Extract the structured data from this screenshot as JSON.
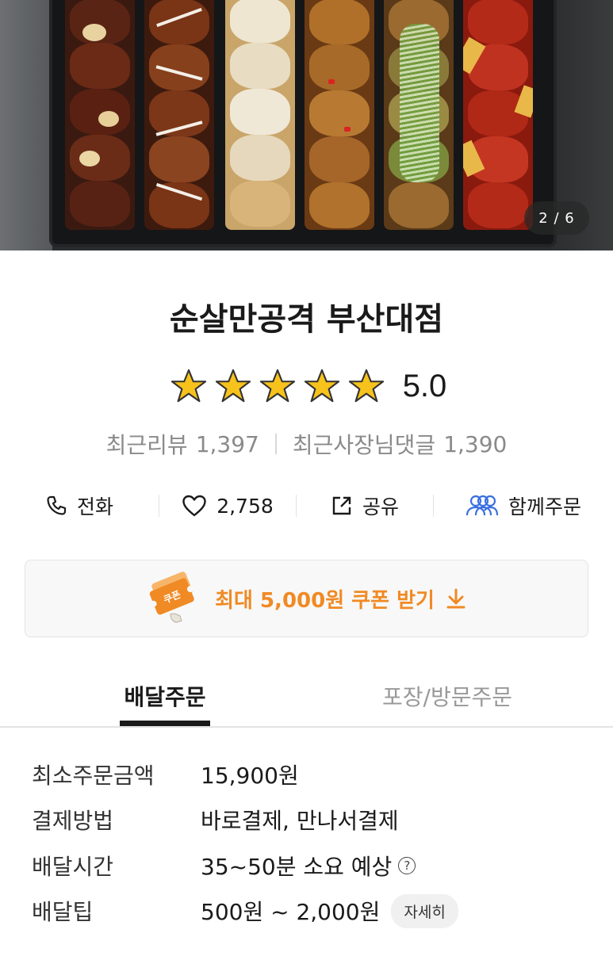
{
  "hero": {
    "page_indicator": "2 / 6",
    "current_index": 2,
    "total": 6
  },
  "store": {
    "name": "순살만공격 부산대점",
    "rating": "5.0",
    "rating_stars": 5,
    "recent_reviews_label": "최근리뷰",
    "recent_reviews_count": "1,397",
    "owner_replies_label": "최근사장님댓글",
    "owner_replies_count": "1,390"
  },
  "actions": {
    "call_label": "전화",
    "call_icon": "phone-icon",
    "like_count": "2,758",
    "like_icon": "heart-icon",
    "share_label": "공유",
    "share_icon": "share-icon",
    "group_order_label": "함께주문",
    "group_order_icon": "group-icon"
  },
  "coupon": {
    "label": "최대 5,000원 쿠폰 받기",
    "ticket_text": "쿠폰",
    "accent_color": "#f08a24"
  },
  "tabs": [
    {
      "label": "배달주문",
      "active": true
    },
    {
      "label": "포장/방문주문",
      "active": false
    }
  ],
  "info": {
    "min_order_label": "최소주문금액",
    "min_order_value": "15,900원",
    "payment_label": "결제방법",
    "payment_value": "바로결제, 만나서결제",
    "delivery_time_label": "배달시간",
    "delivery_time_value": "35~50분 소요 예상",
    "delivery_tip_label": "배달팁",
    "delivery_tip_value": "500원 ~ 2,000원",
    "detail_button": "자세히"
  }
}
